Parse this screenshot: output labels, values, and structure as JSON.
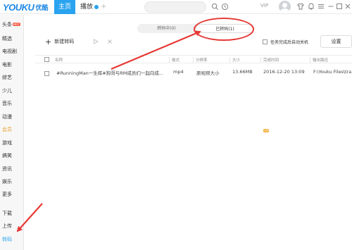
{
  "header": {
    "logo_text": "YOUKU",
    "logo_cn": "优酷",
    "nav_home": "主页",
    "nav_play": "播放",
    "nav_plus": "+",
    "search_placeholder": "",
    "vip_label": "VIP"
  },
  "sidebar": {
    "items": [
      {
        "label": "头条",
        "badge": "HOT"
      },
      {
        "label": "精选"
      },
      {
        "label": "电视剧"
      },
      {
        "label": "电影"
      },
      {
        "label": "综艺"
      },
      {
        "label": "少儿"
      },
      {
        "label": "音乐"
      },
      {
        "label": "动漫"
      },
      {
        "label": "会员",
        "badge": "VIP"
      },
      {
        "label": "游戏"
      },
      {
        "label": "搞笑"
      },
      {
        "label": "资讯"
      },
      {
        "label": "娱乐"
      },
      {
        "label": "更多"
      },
      {
        "label": "下载"
      },
      {
        "label": "上传"
      },
      {
        "label": "转码"
      }
    ]
  },
  "transcode": {
    "tab_in_progress": "转码中(0)",
    "tab_done": "已转码(1)",
    "new_button": "新建转码",
    "auto_shutdown_label": "任务完成后自动关机",
    "settings_button": "设置"
  },
  "table": {
    "headers": [
      "名称",
      "格式",
      "分辨率",
      "大小",
      "完成时间",
      "输出路径"
    ],
    "rows": [
      [
        "#RunningMan一生挥#狗哥与RM成员们一起向成...",
        "mp4",
        "原视频大小",
        "13.66MB",
        "2016-12-20 13:09",
        "F:\\Youku Files\\tra"
      ]
    ]
  },
  "colors": {
    "accent": "#29a3ef",
    "annotation": "#e53935"
  }
}
